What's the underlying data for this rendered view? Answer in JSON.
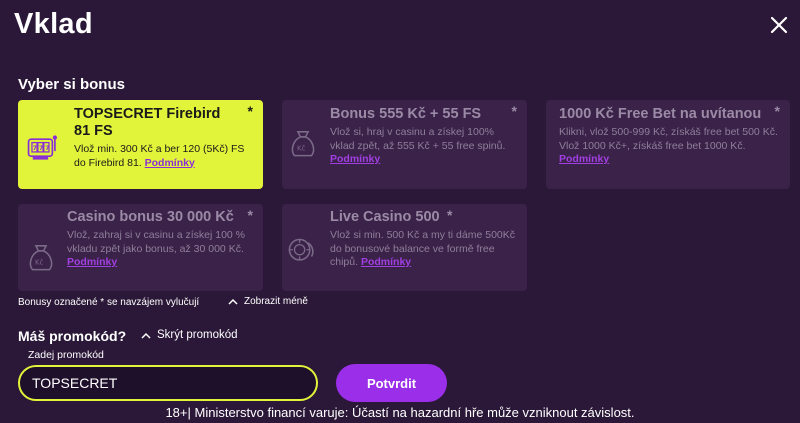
{
  "header": {
    "title": "Vklad",
    "close_icon": "close-icon"
  },
  "bonus_section": {
    "title": "Vyber si bonus",
    "cards": [
      {
        "title": "TOPSECRET Firebird 81 FS",
        "star": "*",
        "desc": "Vlož min. 300 Kč a ber 120 (5Kč) FS do Firebird 81.",
        "terms": "Podmínky",
        "icon": "slot-machine-icon",
        "selected": true
      },
      {
        "title": "Bonus 555 Kč + 55 FS",
        "star": "*",
        "desc": "Vlož si, hraj v casinu a získej 100% vklad zpět, až 555 Kč + 55 free spinů.",
        "terms": "Podmínky",
        "icon": "money-bag-icon",
        "selected": false
      },
      {
        "title": "1000 Kč Free Bet na uvítanou",
        "star": "*",
        "desc": "Klikni, vlož 500-999 Kč, získáš free bet 500 Kč. Vlož 1000 Kč+, získáš free bet 1000 Kč.",
        "terms": "Podmínky",
        "icon": "",
        "selected": false
      },
      {
        "title": "Casino bonus 30 000 Kč",
        "star": "*",
        "desc": "Vlož, zahraj si v casinu a získej 100 % vkladu zpět jako bonus, až 30 000 Kč.",
        "terms": "Podmínky",
        "icon": "money-bag-icon",
        "selected": false
      },
      {
        "title": "Live Casino 500",
        "star": "*",
        "desc": "Vlož si min. 500 Kč a my ti dáme 500Kč do bonusové balance ve formě free chipů.",
        "terms": "Podmínky",
        "icon": "casino-chips-icon",
        "selected": false
      }
    ],
    "footnote": "Bonusy označené * se navzájem vylučují",
    "show_less": "Zobrazit méně"
  },
  "promo": {
    "title": "Máš promokód?",
    "hide_label": "Skrýt promokód",
    "input_label": "Zadej promokód",
    "input_value": "TOPSECRET",
    "confirm_label": "Potvrdit"
  },
  "disclaimer": "18+| Ministerstvo financí varuje: Účastí na hazardní hře může vzniknout závislost.",
  "colors": {
    "background": "#2b1838",
    "card": "#3b2249",
    "selected_card": "#e2f43a",
    "accent_purple": "#9b2ee8"
  }
}
